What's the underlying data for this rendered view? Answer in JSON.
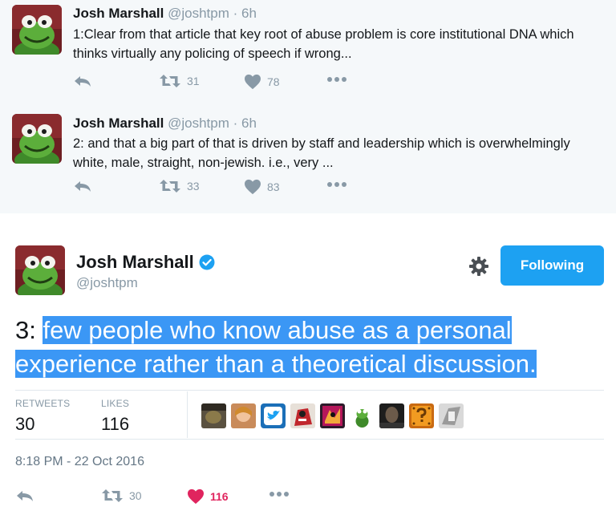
{
  "tweets": [
    {
      "name": "Josh Marshall",
      "handle": "@joshtpm",
      "dot": "·",
      "time": "6h",
      "text": "1:Clear from that article that key root of abuse problem is core institutional DNA which thinks virtually any policing of speech if wrong...",
      "retweets": "31",
      "likes": "78"
    },
    {
      "name": "Josh Marshall",
      "handle": "@joshtpm",
      "dot": "·",
      "time": "6h",
      "text": "2: and that a big part of that is driven by staff and leadership which is overwhelmingly white, male, straight, non-jewish. i.e., very ...",
      "retweets": "33",
      "likes": "83"
    }
  ],
  "main_tweet": {
    "name": "Josh Marshall",
    "handle": "@joshtpm",
    "follow_label": "Following",
    "text_prefix": "3: ",
    "text_line1": "few people who know abuse as a personal",
    "text_line2": "experience rather than a theoretical discussion.",
    "retweets_label": "RETWEETS",
    "retweets": "30",
    "likes_label": "LIKES",
    "likes": "116",
    "timestamp": "8:18 PM - 22 Oct 2016",
    "action_retweets": "30",
    "action_likes": "116"
  },
  "colors": {
    "accent": "#1da1f2",
    "highlight": "#3b97f5",
    "like_red": "#e0245e",
    "muted": "#8899a6",
    "parent_bg": "#f5f8fa"
  },
  "icons": [
    "reply-icon",
    "retweet-icon",
    "heart-icon",
    "more-icon",
    "gear-icon",
    "verified-badge-icon"
  ]
}
